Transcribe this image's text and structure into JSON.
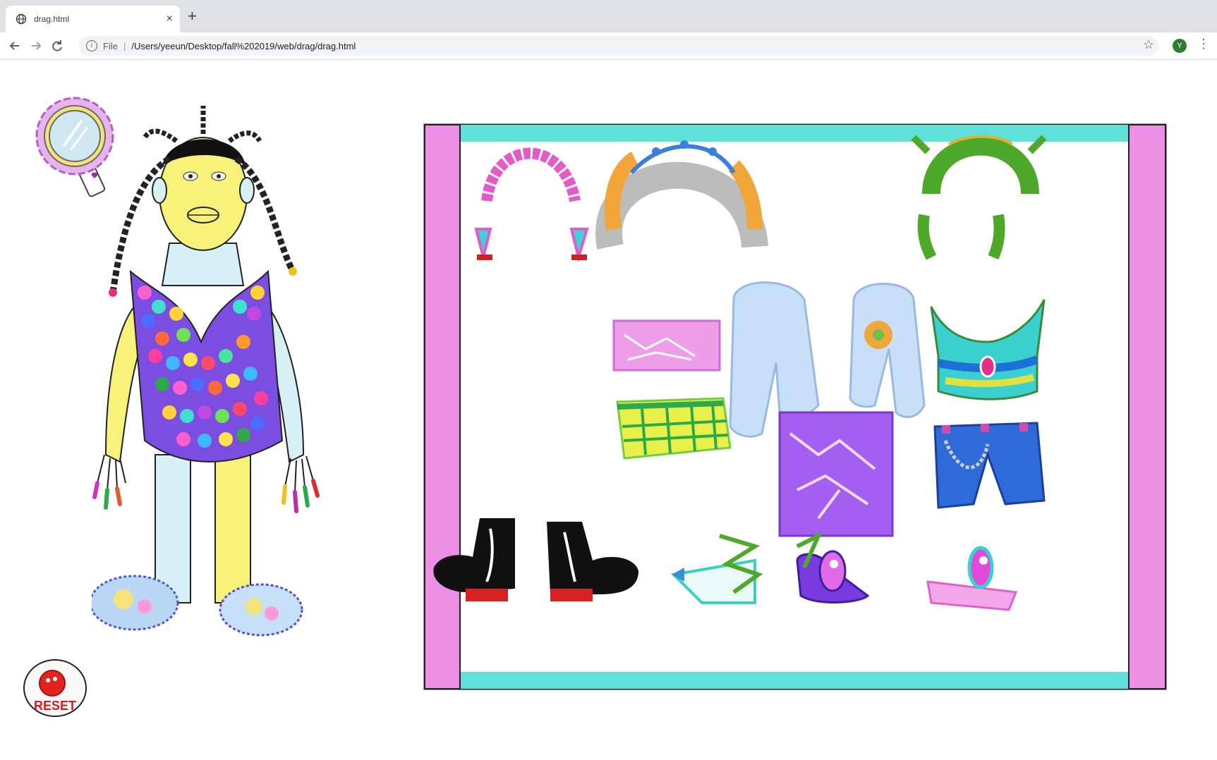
{
  "browser": {
    "tab_title": "drag.html",
    "tab_close": "×",
    "new_tab": "+",
    "scheme_label": "File",
    "separator": "|",
    "url": "/Users/yeeun/Desktop/fall%202019/web/drag/drag.html",
    "profile_initial": "Y",
    "icons": [
      "back-icon",
      "forward-icon",
      "reload-icon",
      "info-icon",
      "star-icon",
      "menu-icon",
      "globe-icon"
    ]
  },
  "game": {
    "reset_label": "RESET",
    "closet_items": [
      "pink-hair",
      "tiara-hair",
      "green-hair",
      "pink-skirt",
      "cloud-jacket",
      "tie-dye-top",
      "plaid-skirt",
      "purple-dress",
      "denim-shorts",
      "black-boots",
      "green-sandals",
      "purple-shoes",
      "pink-slides"
    ],
    "colors": {
      "closet_frame_side": "#ee8fe6",
      "closet_frame_top": "#5fe0d8",
      "reset_red": "#e52222"
    }
  }
}
